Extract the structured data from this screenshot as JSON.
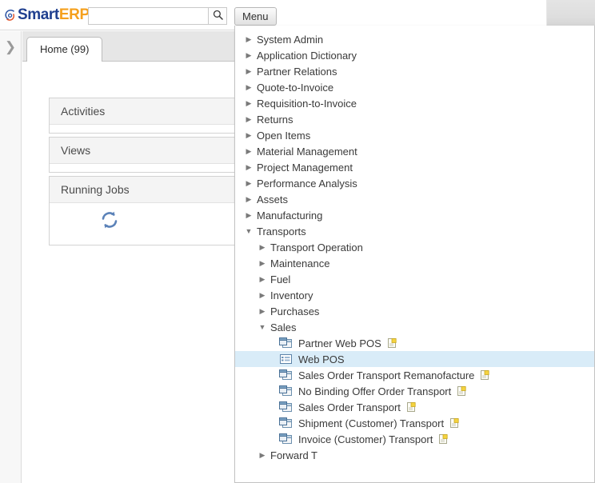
{
  "app": {
    "logo_smart": "Smart",
    "logo_erp": "ERP",
    "logo_mark_icon": "swirl-logo-icon"
  },
  "search": {
    "value": "",
    "placeholder": "",
    "button_icon": "search-icon"
  },
  "toolbar": {
    "menu_label": "Menu"
  },
  "rail": {
    "expand_icon": "chevron-right-icon"
  },
  "tabs": [
    {
      "label": "Home (99)",
      "active": true
    }
  ],
  "panels": [
    {
      "id": "panel-activities",
      "title": "Activities"
    },
    {
      "id": "panel-views",
      "title": "Views"
    },
    {
      "id": "panel-jobs",
      "title": "Running Jobs",
      "body_icon": "refresh-icon"
    }
  ],
  "menu": {
    "items": [
      {
        "label": "System Admin",
        "level": 0,
        "state": "collapsed"
      },
      {
        "label": "Application Dictionary",
        "level": 0,
        "state": "collapsed"
      },
      {
        "label": "Partner Relations",
        "level": 0,
        "state": "collapsed"
      },
      {
        "label": "Quote-to-Invoice",
        "level": 0,
        "state": "collapsed"
      },
      {
        "label": "Requisition-to-Invoice",
        "level": 0,
        "state": "collapsed"
      },
      {
        "label": "Returns",
        "level": 0,
        "state": "collapsed"
      },
      {
        "label": "Open Items",
        "level": 0,
        "state": "collapsed"
      },
      {
        "label": "Material Management",
        "level": 0,
        "state": "collapsed"
      },
      {
        "label": "Project Management",
        "level": 0,
        "state": "collapsed"
      },
      {
        "label": "Performance Analysis",
        "level": 0,
        "state": "collapsed"
      },
      {
        "label": "Assets",
        "level": 0,
        "state": "collapsed"
      },
      {
        "label": "Manufacturing",
        "level": 0,
        "state": "collapsed"
      },
      {
        "label": "Transports",
        "level": 0,
        "state": "expanded"
      },
      {
        "label": "Transport Operation",
        "level": 1,
        "state": "collapsed"
      },
      {
        "label": "Maintenance",
        "level": 1,
        "state": "collapsed"
      },
      {
        "label": "Fuel",
        "level": 1,
        "state": "collapsed"
      },
      {
        "label": "Inventory",
        "level": 1,
        "state": "collapsed"
      },
      {
        "label": "Purchases",
        "level": 1,
        "state": "collapsed"
      },
      {
        "label": "Sales",
        "level": 1,
        "state": "expanded"
      },
      {
        "label": "Partner Web POS",
        "level": 2,
        "state": "leaf",
        "icon": "window-form-icon",
        "note": true
      },
      {
        "label": "Web POS",
        "level": 2,
        "state": "leaf",
        "icon": "list-view-icon",
        "note": false,
        "selected": true
      },
      {
        "label": "Sales Order Transport Remanofacture",
        "level": 2,
        "state": "leaf",
        "icon": "window-form-icon",
        "note": true
      },
      {
        "label": "No Binding Offer Order Transport",
        "level": 2,
        "state": "leaf",
        "icon": "window-form-icon",
        "note": true
      },
      {
        "label": "Sales Order Transport",
        "level": 2,
        "state": "leaf",
        "icon": "window-form-icon",
        "note": true
      },
      {
        "label": "Shipment (Customer) Transport",
        "level": 2,
        "state": "leaf",
        "icon": "window-form-icon",
        "note": true
      },
      {
        "label": "Invoice (Customer) Transport",
        "level": 2,
        "state": "leaf",
        "icon": "window-form-icon",
        "note": true
      },
      {
        "label": "Forward T",
        "level": 1,
        "state": "collapsed"
      }
    ]
  },
  "colors": {
    "logo_blue": "#1f3f8f",
    "logo_orange": "#f5a01d",
    "selection_blue": "#d9ecf8",
    "panel_header_grey": "#f4f4f4",
    "tabstrip_grey": "#e6e6e6"
  }
}
